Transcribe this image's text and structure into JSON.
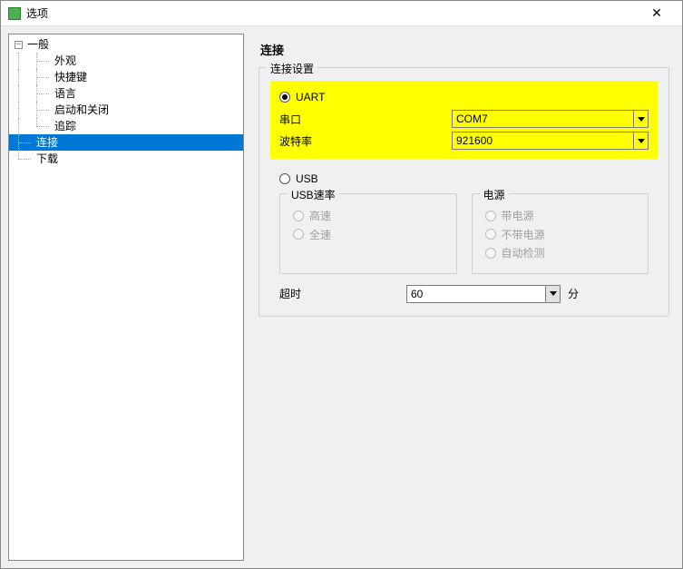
{
  "window": {
    "title": "选项"
  },
  "tree": {
    "root": "一般",
    "children": [
      "外观",
      "快捷键",
      "语言",
      "启动和关闭",
      "追踪"
    ],
    "siblings": [
      "连接",
      "下载"
    ],
    "selected": "连接"
  },
  "page": {
    "title": "连接",
    "conn_group": "连接设置",
    "uart": {
      "label": "UART",
      "port_label": "串口",
      "port_value": "COM7",
      "baud_label": "波特率",
      "baud_value": "921600"
    },
    "usb": {
      "label": "USB",
      "speed_group": "USB速率",
      "speed_high": "高速",
      "speed_full": "全速",
      "power_group": "电源",
      "power_with": "带电源",
      "power_without": "不带电源",
      "power_auto": "自动检测"
    },
    "timeout": {
      "label": "超时",
      "value": "60",
      "unit": "分"
    }
  }
}
